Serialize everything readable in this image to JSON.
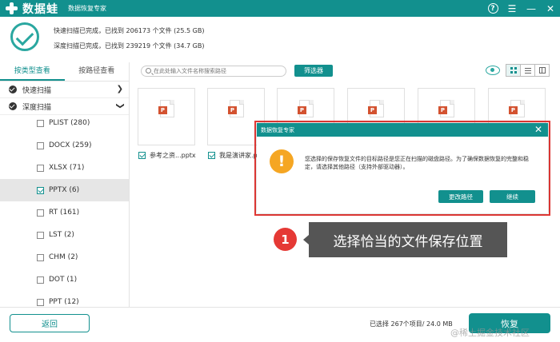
{
  "app": {
    "name": "数据蛙",
    "subtitle": "数据恢复专家"
  },
  "scan": {
    "quick_line": "快速扫描已完成，已找到 206173 个文件 (25.5 GB)",
    "deep_line": "深度扫描已完成，已找到 239219 个文件 (34.7 GB)"
  },
  "sidebar": {
    "tab_by_type": "按类型查看",
    "tab_by_path": "按路径查看",
    "quick_scan": "快速扫描",
    "deep_scan": "深度扫描",
    "items": [
      {
        "label": "PLIST (280)",
        "checked": false
      },
      {
        "label": "DOCX (259)",
        "checked": false
      },
      {
        "label": "XLSX (71)",
        "checked": false
      },
      {
        "label": "PPTX (6)",
        "checked": true
      },
      {
        "label": "RT (161)",
        "checked": false
      },
      {
        "label": "LST (2)",
        "checked": false
      },
      {
        "label": "CHM (2)",
        "checked": false
      },
      {
        "label": "DOT (1)",
        "checked": false
      },
      {
        "label": "PPT (12)",
        "checked": false
      }
    ]
  },
  "toolbar": {
    "search_placeholder": "在此处输入文件名称搜索路径",
    "filter_label": "筛选器"
  },
  "files": [
    {
      "name": "参考之资...pptx"
    },
    {
      "name": "我是演讲家.p"
    }
  ],
  "file_icon_label": "P",
  "footer": {
    "back_label": "返回",
    "summary": "已选择 267个项目/ 24.0 MB",
    "recover_label": "恢复",
    "watermark": "@稀土掘金技术社区"
  },
  "dialog": {
    "title": "数据恢复专家",
    "warn_glyph": "!",
    "message": "您选择的保存恢复文件的目标路径是您正在扫描的磁盘路径。为了确保数据恢复的完整和稳定，请选择其他路径（支持外部驱动器）。",
    "change_path_label": "更改路径",
    "continue_label": "继续"
  },
  "tutorial": {
    "step": "1",
    "caption": "选择恰当的文件保存位置"
  },
  "colors": {
    "primary": "#12908e",
    "accent": "#2aa7a0",
    "warning": "#f5a623",
    "highlight": "#e53935",
    "ppt_badge": "#d35230"
  }
}
